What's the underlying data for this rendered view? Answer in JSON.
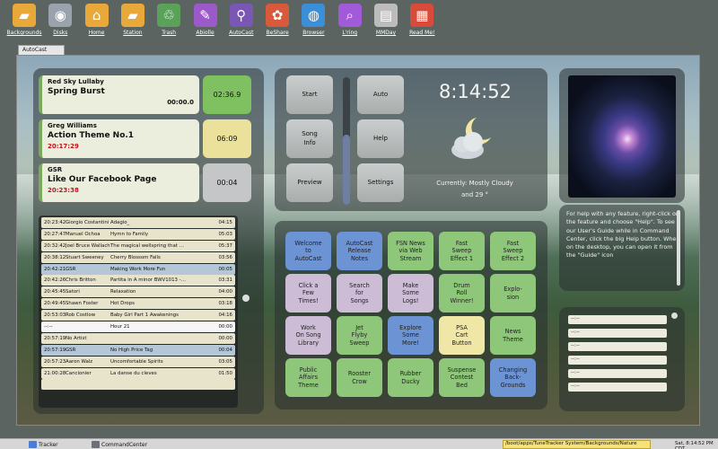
{
  "desktop_icons": [
    {
      "label": "Backgrounds",
      "icon": "folder-icon",
      "color": "#e8a83a"
    },
    {
      "label": "Disks",
      "icon": "disk-icon",
      "color": "#9aa3ad"
    },
    {
      "label": "Home",
      "icon": "home-icon",
      "color": "#e8a83a"
    },
    {
      "label": "Station",
      "icon": "folder-icon",
      "color": "#e8a83a"
    },
    {
      "label": "Trash",
      "icon": "trash-icon",
      "color": "#5aa15a"
    },
    {
      "label": "Abiolle",
      "icon": "paint-icon",
      "color": "#9b59c9"
    },
    {
      "label": "AutoCast",
      "icon": "antenna-icon",
      "color": "#7a57b5"
    },
    {
      "label": "BeShare",
      "icon": "flower-icon",
      "color": "#d85a3a"
    },
    {
      "label": "Browser",
      "icon": "globe-icon",
      "color": "#3a8fd8"
    },
    {
      "label": "L'ring",
      "icon": "magnifier-icon",
      "color": "#a15ad8"
    },
    {
      "label": "MMDay",
      "icon": "document-icon",
      "color": "#bcbcbc"
    },
    {
      "label": "Read Me!",
      "icon": "pdf-icon",
      "color": "#d84a3a"
    }
  ],
  "window": {
    "tab_title": "AutoCast"
  },
  "now_playing": [
    {
      "artist": "Red Sky Lullaby",
      "title": "Spring Burst",
      "time": "00:00.0",
      "time_style": "right",
      "timer": "02:36.9",
      "timer_color": "#7fc060"
    },
    {
      "artist": "Greg Williams",
      "title": "Action Theme No.1",
      "time": "20:17:29",
      "time_style": "red",
      "timer": "06:09",
      "timer_color": "#ece19a"
    },
    {
      "artist": "GSR",
      "title": "Like Our Facebook Page",
      "time": "20:23:38",
      "time_style": "red",
      "timer": "00:04",
      "timer_color": "#c4c6c8"
    }
  ],
  "log": [
    {
      "time": "20:23:42",
      "artist": "Giorgio Costantini",
      "title": "Adagio_",
      "dur": "04:15",
      "style": "tan"
    },
    {
      "time": "20:27:47",
      "artist": "Manuel Ochoa",
      "title": "Hymn to Family",
      "dur": "05:03",
      "style": "tan"
    },
    {
      "time": "20:32:42",
      "artist": "Joel Bruce Wallach",
      "title": "The magical wellspring that …",
      "dur": "05:37",
      "style": "tan"
    },
    {
      "time": "20:38:12",
      "artist": "Stuart Sweeney",
      "title": "Cherry Blossom Falls",
      "dur": "03:56",
      "style": "tan"
    },
    {
      "time": "20:42:21",
      "artist": "GSR",
      "title": "Making Work More Fun",
      "dur": "00:05",
      "style": "blue"
    },
    {
      "time": "20:42:26",
      "artist": "Chris Britton",
      "title": "Partita in A minor BWV1013 -…",
      "dur": "03:31",
      "style": "tan"
    },
    {
      "time": "20:45:45",
      "artist": "Satori",
      "title": "Relaxation",
      "dur": "04:00",
      "style": "tan"
    },
    {
      "time": "20:49:45",
      "artist": "Shawn Foster",
      "title": "Hot Drops",
      "dur": "03:18",
      "style": "tan"
    },
    {
      "time": "20:53:03",
      "artist": "Rob Costlow",
      "title": "Baby Girl Part 1 Awakenings",
      "dur": "04:16",
      "style": "tan"
    },
    {
      "time": "--:--",
      "artist": "",
      "title": "Hour 21",
      "dur": "00:00",
      "style": "white"
    },
    {
      "time": "20:57:19",
      "artist": "No Artist",
      "title": "",
      "dur": "00:00",
      "style": "tan"
    },
    {
      "time": "20:57:19",
      "artist": "GSR",
      "title": "No High Price Tag",
      "dur": "00:04",
      "style": "blue"
    },
    {
      "time": "20:57:23",
      "artist": "Aaron Walz",
      "title": "Uncomfortable Spirits",
      "dur": "03:05",
      "style": "tan"
    },
    {
      "time": "21:00:28",
      "artist": "Cancionier",
      "title": "La danse du cleves",
      "dur": "01:50",
      "style": "tan"
    },
    {
      "time": "",
      "artist": "",
      "title": "",
      "dur": "",
      "style": "tan"
    }
  ],
  "controls": {
    "start": "Start",
    "song_info_1": "Song",
    "song_info_2": "Info",
    "preview": "Preview",
    "auto": "Auto",
    "help": "Help",
    "settings": "Settings",
    "volume_level": 0.55
  },
  "clock": {
    "time": "8:14:52",
    "weather_line1": "Currently: Mostly Cloudy",
    "weather_line2": "and 29 °"
  },
  "shortcuts": [
    {
      "lines": [
        "Welcome",
        "to",
        "AutoCast"
      ],
      "color": "blue"
    },
    {
      "lines": [
        "AutoCast",
        "Release",
        "Notes"
      ],
      "color": "blue"
    },
    {
      "lines": [
        "FSN News",
        "via Web",
        "Stream"
      ],
      "color": "green"
    },
    {
      "lines": [
        "Fast",
        "Sweep",
        "Effect 1"
      ],
      "color": "green"
    },
    {
      "lines": [
        "Fast",
        "Sweep",
        "Effect 2"
      ],
      "color": "green"
    },
    {
      "lines": [
        "Click a",
        "Few",
        "Times!"
      ],
      "color": "lav"
    },
    {
      "lines": [
        "Search",
        "for",
        "Songs"
      ],
      "color": "lav"
    },
    {
      "lines": [
        "Make",
        "Some",
        "Logs!"
      ],
      "color": "lav"
    },
    {
      "lines": [
        "Drum",
        "Roll",
        "Winner!"
      ],
      "color": "green"
    },
    {
      "lines": [
        "Explo-",
        "sion"
      ],
      "color": "green"
    },
    {
      "lines": [
        "Work",
        "On Song",
        "Library"
      ],
      "color": "lav"
    },
    {
      "lines": [
        "Jet",
        "Flyby",
        "Sweep"
      ],
      "color": "green"
    },
    {
      "lines": [
        "Explore",
        "Some",
        "More!"
      ],
      "color": "blue"
    },
    {
      "lines": [
        "PSA",
        "Cart",
        "Button"
      ],
      "color": "yellow"
    },
    {
      "lines": [
        "News",
        "Theme"
      ],
      "color": "green"
    },
    {
      "lines": [
        "Public",
        "Affairs",
        "Theme"
      ],
      "color": "green"
    },
    {
      "lines": [
        "Rooster",
        "Crow"
      ],
      "color": "green"
    },
    {
      "lines": [
        "Rubber",
        "Ducky"
      ],
      "color": "green"
    },
    {
      "lines": [
        "Suspense",
        "Contest",
        "Bed"
      ],
      "color": "green"
    },
    {
      "lines": [
        "Changing",
        "Back-",
        "Grounds"
      ],
      "color": "blue"
    }
  ],
  "help_text": "For help with any feature, right-click on the feature and choose \"Help\".  To see our User's Guide while in Command Center, click the big Help button. When on the desktop, you can open it from the \"Guide\" icon",
  "slots": [
    "--:--",
    "--:--",
    "--:--",
    "--:--",
    "--:--",
    "--:--"
  ],
  "taskbar": {
    "items": [
      {
        "label": "Tracker",
        "icon": "tracker-icon"
      },
      {
        "label": "CommandCenter",
        "icon": "app-icon"
      }
    ],
    "path": "/boot/apps/TuneTracker System/Backgrounds/Nature",
    "clock": "Sat, 8:14:52 PM CDT"
  }
}
